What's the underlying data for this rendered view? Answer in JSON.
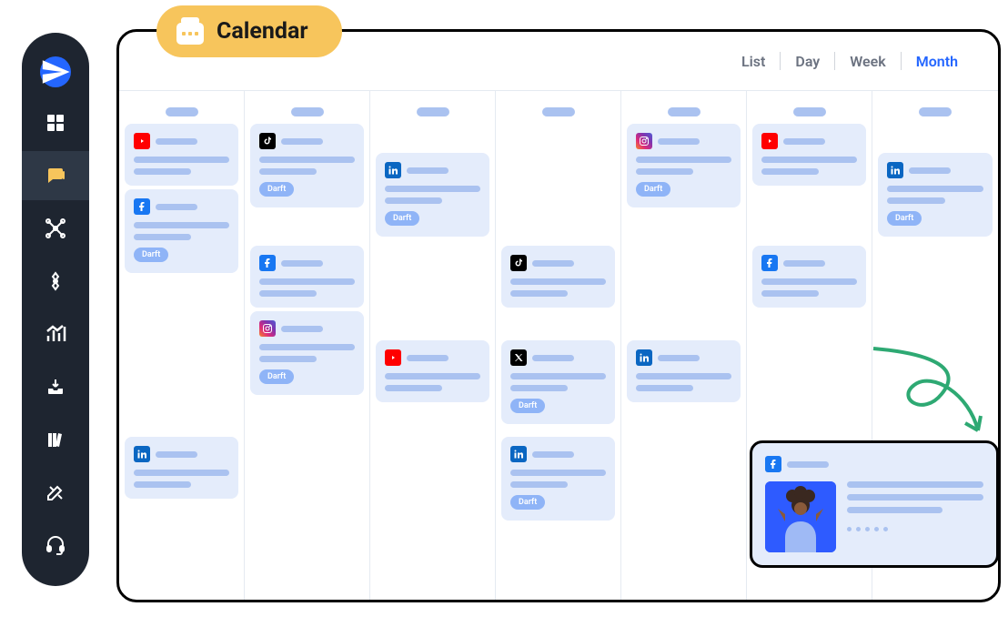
{
  "header": {
    "title": "Calendar",
    "views": [
      "List",
      "Day",
      "Week",
      "Month"
    ],
    "active_view": "Month"
  },
  "sidebar": {
    "items": [
      {
        "name": "navigate-icon"
      },
      {
        "name": "dashboard-icon"
      },
      {
        "name": "conversations-icon",
        "active": true
      },
      {
        "name": "network-icon"
      },
      {
        "name": "target-icon"
      },
      {
        "name": "analytics-icon"
      },
      {
        "name": "inbox-icon"
      },
      {
        "name": "library-icon"
      },
      {
        "name": "tools-icon"
      },
      {
        "name": "support-icon"
      }
    ]
  },
  "draft_label": "Darft",
  "calendar": {
    "columns": [
      [
        {
          "network": "youtube"
        },
        {
          "network": "facebook",
          "status": "draft"
        },
        {
          "network": "linkedin",
          "pos": "bottom"
        }
      ],
      [
        {
          "network": "tiktok",
          "status": "draft"
        },
        {
          "network": "facebook",
          "pos": "mid"
        },
        {
          "network": "instagram",
          "status": "draft"
        }
      ],
      [
        {
          "network": "linkedin",
          "status": "draft",
          "pos": "second"
        },
        {
          "network": "youtube",
          "pos": "low"
        }
      ],
      [
        {
          "network": "tiktok",
          "pos": "mid"
        },
        {
          "network": "x",
          "status": "draft",
          "pos": "low"
        },
        {
          "network": "linkedin",
          "status": "draft",
          "pos": "bottom"
        }
      ],
      [
        {
          "network": "instagram",
          "status": "draft"
        },
        {
          "network": "linkedin",
          "pos": "low"
        }
      ],
      [
        {
          "network": "youtube"
        },
        {
          "network": "facebook",
          "pos": "mid"
        }
      ],
      [
        {
          "network": "linkedin",
          "status": "draft",
          "pos": "second"
        }
      ]
    ]
  },
  "popout": {
    "network": "facebook"
  }
}
